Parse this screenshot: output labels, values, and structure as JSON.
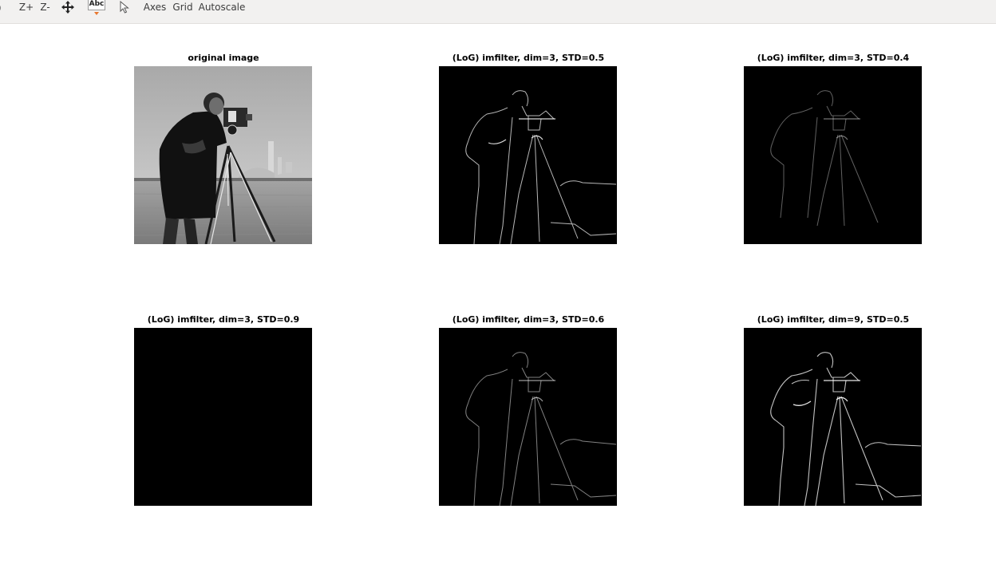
{
  "toolbar": {
    "zoom_in_label": "Z+",
    "zoom_out_label": "Z-",
    "text_tool_label": "Abc",
    "axes_label": "Axes",
    "grid_label": "Grid",
    "autoscale_label": "Autoscale",
    "icons": {
      "pan": "pan-arrows-icon",
      "text": "text-tool-icon",
      "select": "select-pointer-icon"
    },
    "accent_color": "#e8772e"
  },
  "figure": {
    "subplots": [
      {
        "title": "original image",
        "kind": "grayscale-photo",
        "intensity": 1.0
      },
      {
        "title": "(LoG) imfilter, dim=3, STD=0.5",
        "kind": "edge-map",
        "intensity": 0.85
      },
      {
        "title": "(LoG) imfilter, dim=3, STD=0.4",
        "kind": "edge-map",
        "intensity": 0.45
      },
      {
        "title": "(LoG) imfilter, dim=3, STD=0.9",
        "kind": "blank",
        "intensity": 0.0
      },
      {
        "title": "(LoG) imfilter, dim=3, STD=0.6",
        "kind": "edge-map",
        "intensity": 0.6
      },
      {
        "title": "(LoG) imfilter, dim=9, STD=0.5",
        "kind": "edge-map",
        "intensity": 0.9
      }
    ]
  }
}
